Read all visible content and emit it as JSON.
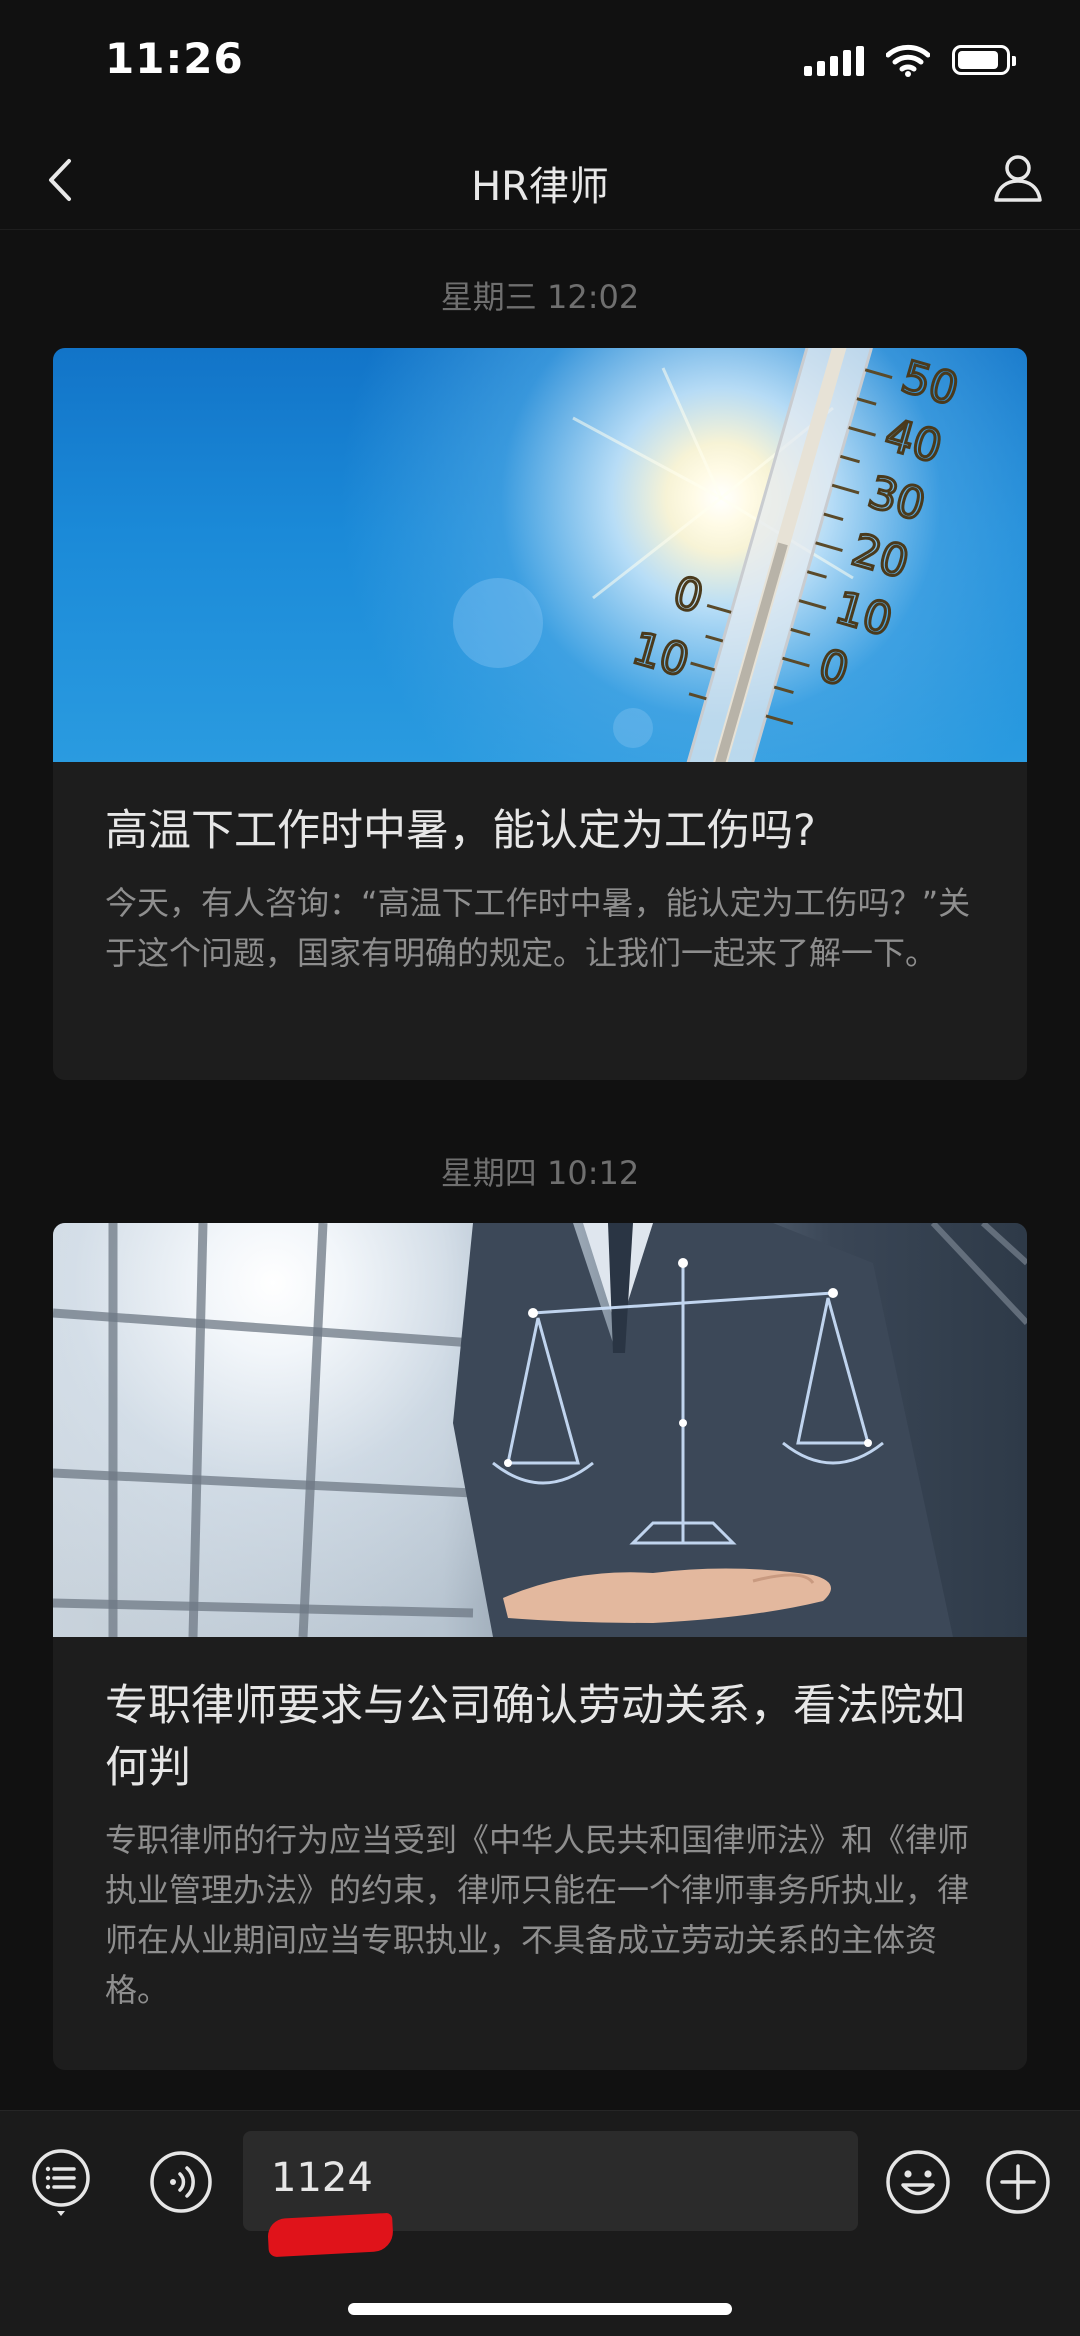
{
  "status_bar": {
    "time": "11:26"
  },
  "nav": {
    "title": "HR律师"
  },
  "messages": [
    {
      "timestamp": "星期三 12:02",
      "title": "高温下工作时中暑，能认定为工伤吗?",
      "description": "今天，有人咨询：“高温下工作时中暑，能认定为工伤吗？”关于这个问题，国家有明确的规定。让我们一起来了解一下。",
      "thermometer_labels": [
        "50",
        "40",
        "30",
        "20",
        "10",
        "0",
        "0",
        "10"
      ]
    },
    {
      "timestamp": "星期四 10:12",
      "title": "专职律师要求与公司确认劳动关系，看法院如何判",
      "description": "专职律师的行为应当受到《中华人民共和国律师法》和《律师执业管理办法》的约束，律师只能在一个律师事务所执业，律师在从业期间应当专职执业，不具备成立劳动关系的主体资格。"
    }
  ],
  "input_bar": {
    "value": "1124",
    "icons": [
      "menu-icon",
      "voice-icon",
      "emoji-icon",
      "add-icon"
    ]
  },
  "colors": {
    "background": "#111111",
    "card": "#1d1d1d",
    "input_bar": "#1b1b1b",
    "redaction": "#e0131a"
  }
}
